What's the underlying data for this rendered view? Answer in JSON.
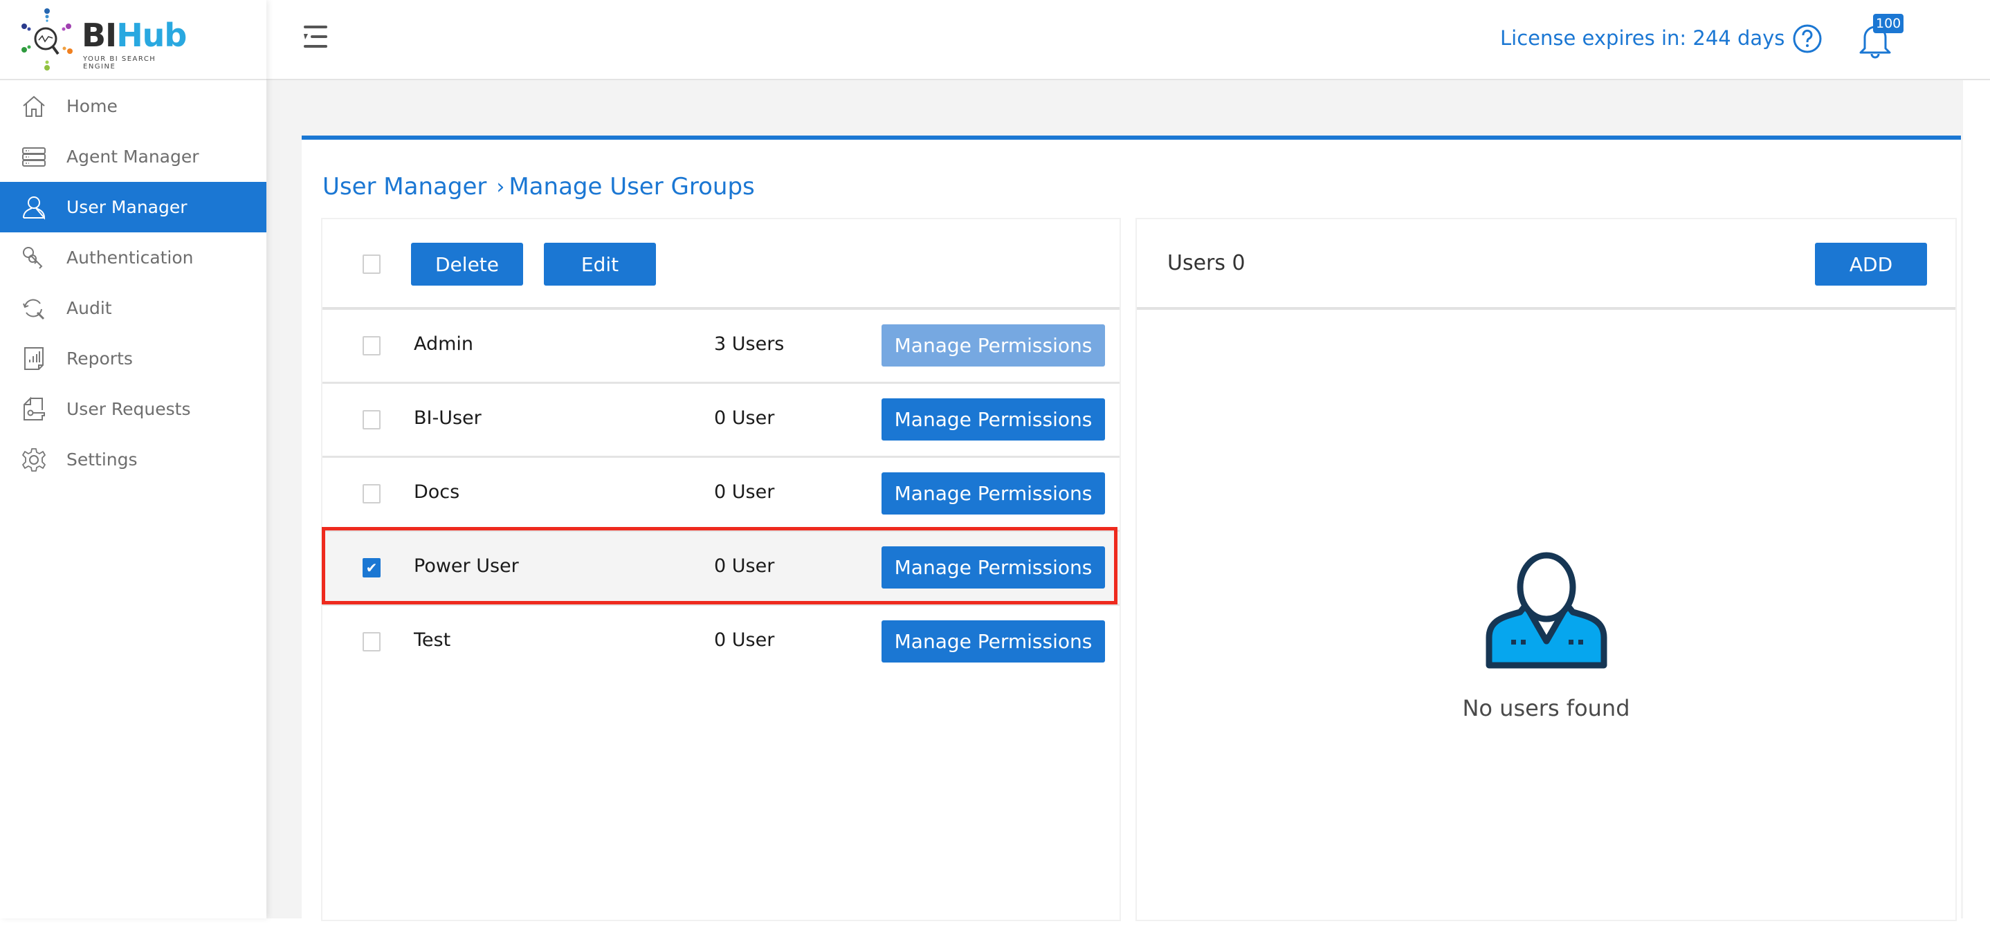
{
  "brand": {
    "name_part1": "BI",
    "name_part2": "Hub",
    "tagline": "YOUR BI SEARCH ENGINE"
  },
  "sidebar": {
    "items": [
      {
        "label": "Home",
        "icon": "home-icon",
        "active": false
      },
      {
        "label": "Agent Manager",
        "icon": "server-icon",
        "active": false
      },
      {
        "label": "User Manager",
        "icon": "user-icon",
        "active": true
      },
      {
        "label": "Authentication",
        "icon": "keys-icon",
        "active": false
      },
      {
        "label": "Audit",
        "icon": "audit-search-icon",
        "active": false
      },
      {
        "label": "Reports",
        "icon": "report-icon",
        "active": false
      },
      {
        "label": "User Requests",
        "icon": "request-key-icon",
        "active": false
      },
      {
        "label": "Settings",
        "icon": "gear-icon",
        "active": false
      }
    ]
  },
  "header": {
    "license_text": "License expires in: 244 days",
    "notification_count": "100",
    "accent_color": "#1b77d3"
  },
  "breadcrumb": {
    "items": [
      "User Manager",
      "Manage User Groups"
    ],
    "separator": ">"
  },
  "groups_panel": {
    "delete_label": "Delete",
    "edit_label": "Edit",
    "rows": [
      {
        "name": "Admin",
        "count": "3 Users",
        "button": "Manage Permissions",
        "checked": false,
        "button_disabled": true
      },
      {
        "name": "BI-User",
        "count": "0 User",
        "button": "Manage Permissions",
        "checked": false,
        "button_disabled": false
      },
      {
        "name": "Docs",
        "count": "0 User",
        "button": "Manage Permissions",
        "checked": false,
        "button_disabled": false
      },
      {
        "name": "Power User",
        "count": "0 User",
        "button": "Manage Permissions",
        "checked": true,
        "button_disabled": false
      },
      {
        "name": "Test",
        "count": "0 User",
        "button": "Manage Permissions",
        "checked": false,
        "button_disabled": false
      }
    ]
  },
  "users_panel": {
    "title": "Users 0",
    "add_label": "ADD",
    "empty_text": "No users found"
  },
  "annotation": {
    "highlight_color": "#ee2a1e",
    "highlighted_row": "Power User"
  }
}
